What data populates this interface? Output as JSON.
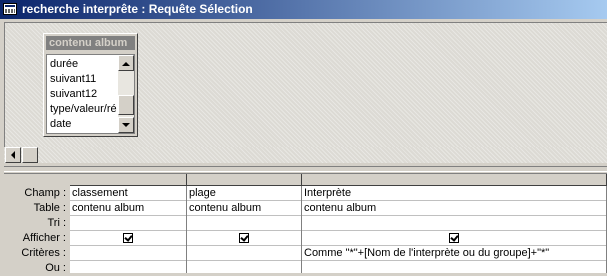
{
  "window": {
    "title": "recherche interprête : Requête Sélection"
  },
  "field_list": {
    "table_name": "contenu album",
    "items": [
      "durée",
      "suivant11",
      "suivant12",
      "type/valeur/ré",
      "date"
    ]
  },
  "grid": {
    "row_labels": [
      "Champ :",
      "Table :",
      "Tri :",
      "Afficher :",
      "Critères :",
      "Ou :"
    ],
    "columns": [
      {
        "champ": "classement",
        "table": "contenu album",
        "tri": "",
        "afficher": true,
        "criteres": "",
        "ou": ""
      },
      {
        "champ": "plage",
        "table": "contenu album",
        "tri": "",
        "afficher": true,
        "criteres": "",
        "ou": ""
      },
      {
        "champ": "Interprète",
        "table": "contenu album",
        "tri": "",
        "afficher": true,
        "criteres": "Comme \"*\"+[Nom de l'interprète ou du groupe]+\"*\"",
        "ou": ""
      }
    ]
  },
  "icons": {
    "window": "query-window-icon",
    "scroll_up": "scroll-up-arrow-icon",
    "scroll_down": "scroll-down-arrow-icon",
    "scroll_left": "scroll-left-arrow-icon",
    "checkmark": "checkbox-checked-icon"
  },
  "colors": {
    "title_bar_start": "#0a246a",
    "title_bar_end": "#a6caf0",
    "field_list_title": "#808080",
    "face": "#d4d0c8"
  }
}
